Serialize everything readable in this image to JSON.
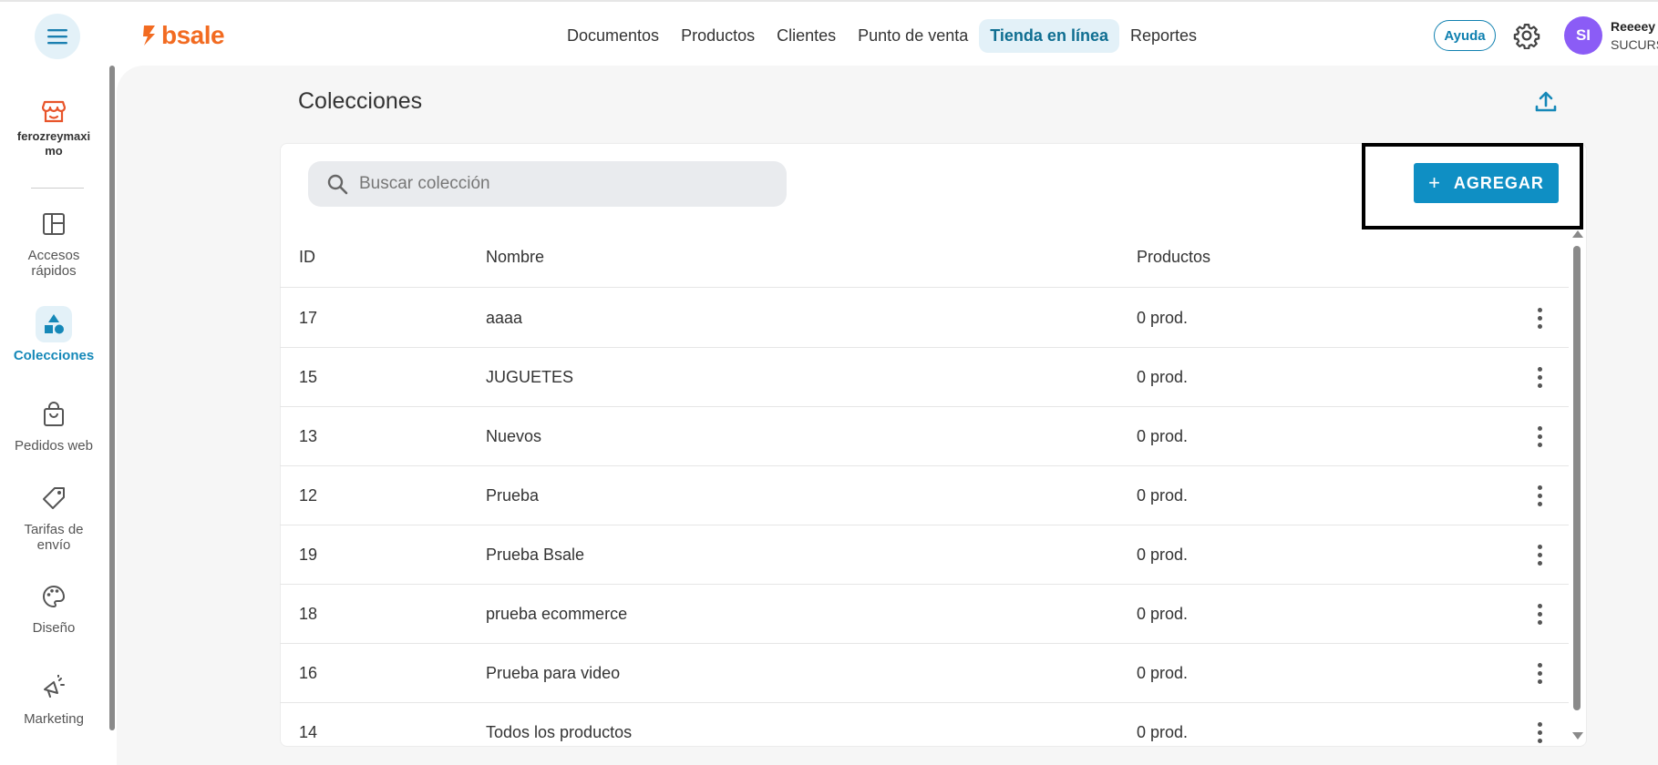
{
  "header": {
    "brand": "bsale",
    "nav": [
      {
        "label": "Documentos",
        "active": false
      },
      {
        "label": "Productos",
        "active": false
      },
      {
        "label": "Clientes",
        "active": false
      },
      {
        "label": "Punto de venta",
        "active": false
      },
      {
        "label": "Tienda en línea",
        "active": true
      },
      {
        "label": "Reportes",
        "active": false
      }
    ],
    "help_label": "Ayuda",
    "avatar_initials": "SI",
    "user_name": "Reeeey",
    "user_branch": "SUCURS"
  },
  "sidebar": {
    "store_name": "ferozreymaximo",
    "items": [
      {
        "label": "Accesos rápidos",
        "icon": "layout-icon",
        "active": false
      },
      {
        "label": "Colecciones",
        "icon": "shapes-icon",
        "active": true
      },
      {
        "label": "Pedidos web",
        "icon": "shopping-bag-icon",
        "active": false
      },
      {
        "label": "Tarifas de envío",
        "icon": "tag-icon",
        "active": false
      },
      {
        "label": "Diseño",
        "icon": "palette-icon",
        "active": false
      },
      {
        "label": "Marketing",
        "icon": "megaphone-icon",
        "active": false
      }
    ]
  },
  "main": {
    "title": "Colecciones",
    "search_placeholder": "Buscar colección",
    "add_label": "AGREGAR",
    "columns": {
      "id": "ID",
      "name": "Nombre",
      "products": "Productos"
    },
    "rows": [
      {
        "id": "17",
        "name": "aaaa",
        "products": "0 prod."
      },
      {
        "id": "15",
        "name": "JUGUETES",
        "products": "0 prod."
      },
      {
        "id": "13",
        "name": "Nuevos",
        "products": "0 prod."
      },
      {
        "id": "12",
        "name": "Prueba",
        "products": "0 prod."
      },
      {
        "id": "19",
        "name": "Prueba Bsale",
        "products": "0 prod."
      },
      {
        "id": "18",
        "name": "prueba ecommerce",
        "products": "0 prod."
      },
      {
        "id": "16",
        "name": "Prueba para video",
        "products": "0 prod."
      },
      {
        "id": "14",
        "name": "Todos los productos",
        "products": "0 prod."
      }
    ]
  },
  "colors": {
    "accent": "#0f8fc4",
    "brand": "#f26b21",
    "avatar": "#8b5cf6"
  }
}
